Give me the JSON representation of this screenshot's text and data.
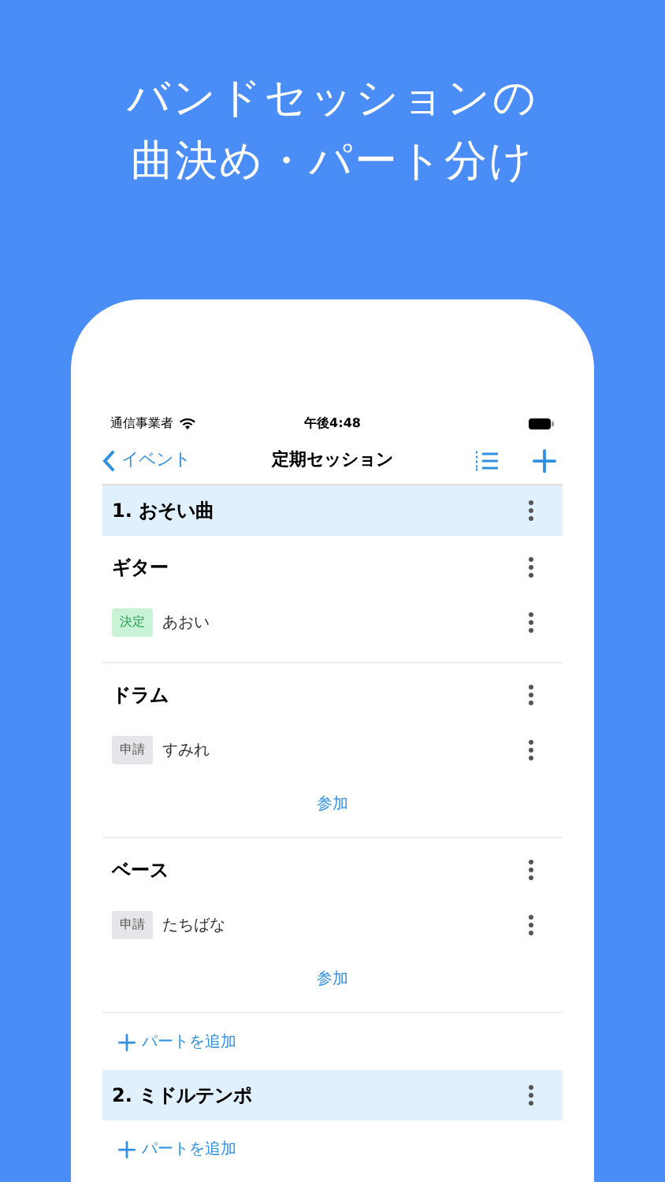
{
  "headline": [
    "バンドセッションの",
    "曲決め・パート分け"
  ],
  "status_bar": {
    "carrier": "通信事業者",
    "time": "午後4:48"
  },
  "nav": {
    "back": "イベント",
    "title": "定期セッション"
  },
  "songs": [
    {
      "title": "1. おそい曲",
      "parts": [
        {
          "name": "ギター",
          "members": [
            {
              "badge": "決定",
              "kind": "decided",
              "name": "あおい"
            }
          ]
        },
        {
          "name": "ドラム",
          "members": [
            {
              "badge": "申請",
              "kind": "applied",
              "name": "すみれ"
            }
          ],
          "join": "参加"
        },
        {
          "name": "ベース",
          "members": [
            {
              "badge": "申請",
              "kind": "applied",
              "name": "たちばな"
            }
          ],
          "join": "参加"
        }
      ],
      "add_part": "パートを追加"
    },
    {
      "title": "2. ミドルテンポ",
      "add_part": "パートを追加"
    }
  ]
}
